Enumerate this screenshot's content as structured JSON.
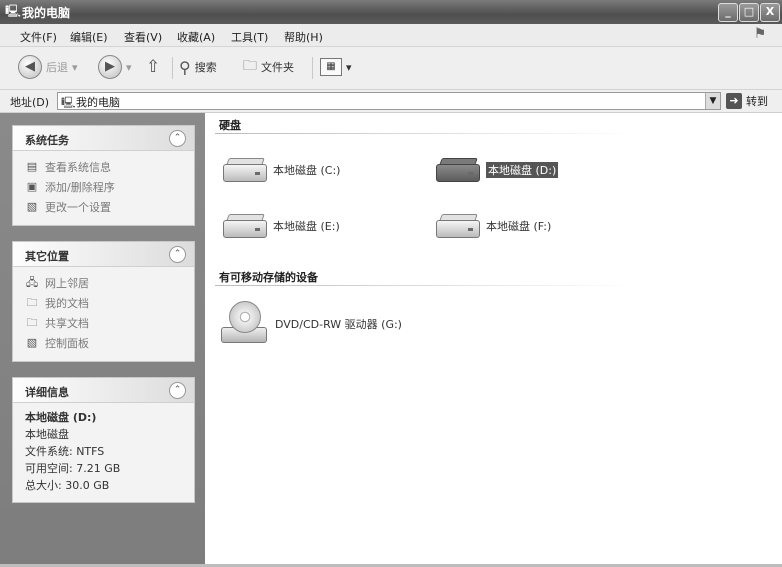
{
  "window": {
    "title": "我的电脑",
    "controls": {
      "minimize": "_",
      "maximize": "□",
      "close": "X"
    }
  },
  "menu": [
    "文件(F)",
    "编辑(E)",
    "查看(V)",
    "收藏(A)",
    "工具(T)",
    "帮助(H)"
  ],
  "toolbar": {
    "back": "后退",
    "search": "搜索",
    "folders": "文件夹"
  },
  "address": {
    "label": "地址(D)",
    "value": "我的电脑",
    "go": "转到"
  },
  "sidebar": {
    "system_tasks": {
      "title": "系统任务",
      "items": [
        "查看系统信息",
        "添加/删除程序",
        "更改一个设置"
      ]
    },
    "other_places": {
      "title": "其它位置",
      "items": [
        "网上邻居",
        "我的文档",
        "共享文档",
        "控制面板"
      ]
    },
    "details": {
      "title": "详细信息",
      "name": "本地磁盘 (D:)",
      "type": "本地磁盘",
      "fs": "文件系统: NTFS",
      "free": "可用空间: 7.21 GB",
      "total": "总大小: 30.0 GB"
    }
  },
  "content": {
    "hard_disks_heading": "硬盘",
    "drives": [
      {
        "label": "本地磁盘 (C:)",
        "selected": false
      },
      {
        "label": "本地磁盘 (D:)",
        "selected": true
      },
      {
        "label": "本地磁盘 (E:)",
        "selected": false
      },
      {
        "label": "本地磁盘 (F:)",
        "selected": false
      }
    ],
    "removable_heading": "有可移动存储的设备",
    "removable": [
      {
        "label": "DVD/CD-RW 驱动器 (G:)"
      }
    ]
  },
  "colors": {
    "titlebar": "#5a5a5a",
    "sidepane": "#858585",
    "selection": "#555555"
  }
}
